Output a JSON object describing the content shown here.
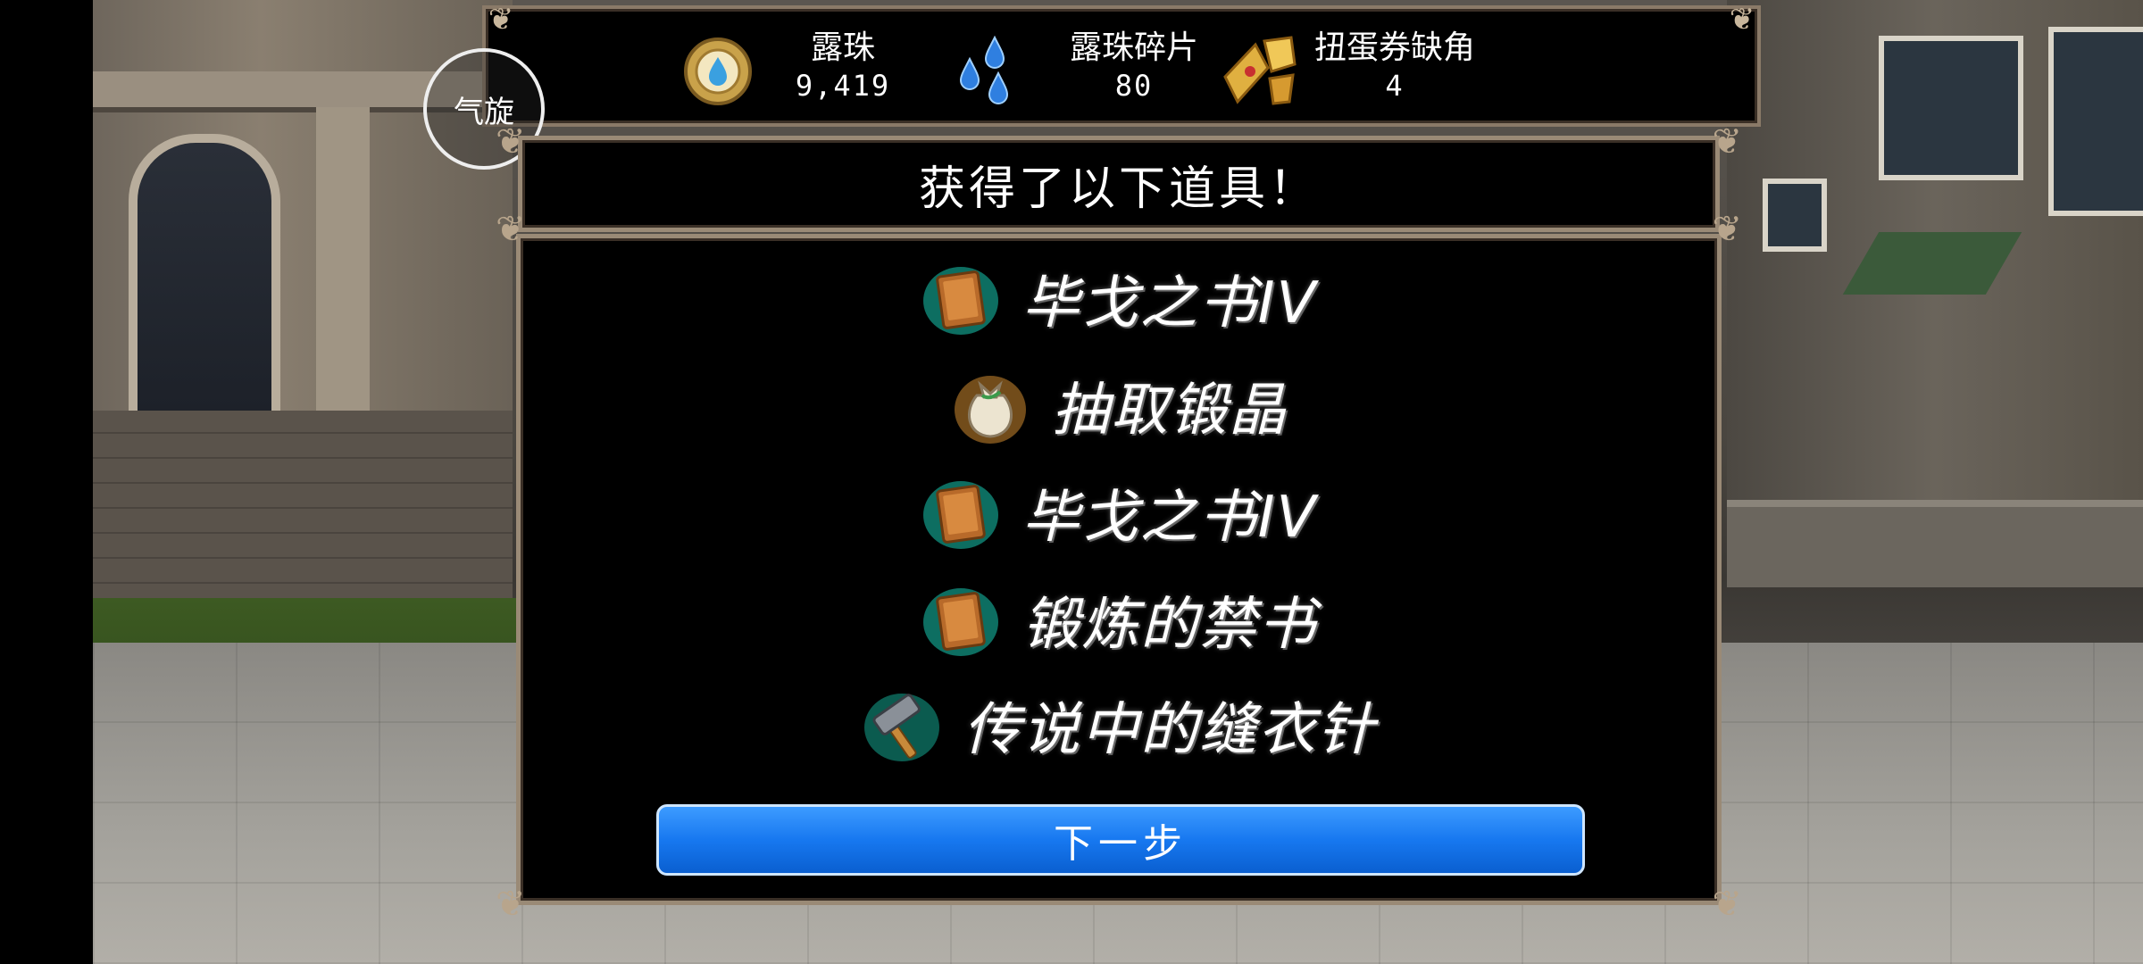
{
  "currencies": [
    {
      "name": "露珠",
      "value": "9,419",
      "icon": "dew-orb-icon"
    },
    {
      "name": "露珠碎片",
      "value": "80",
      "icon": "dew-fragment-icon"
    },
    {
      "name": "扭蛋券缺角",
      "value": "4",
      "icon": "gacha-ticket-fragment-icon"
    }
  ],
  "qixuan_button": {
    "label": "气旋"
  },
  "dialog": {
    "title": "获得了以下道具！",
    "items": [
      {
        "label": "毕戈之书IV",
        "icon": "book-icon"
      },
      {
        "label": "抽取锻晶",
        "icon": "pouch-icon"
      },
      {
        "label": "毕戈之书IV",
        "icon": "book-icon"
      },
      {
        "label": "锻炼的禁书",
        "icon": "book-icon"
      },
      {
        "label": "传说中的缝衣针",
        "icon": "hammer-icon"
      }
    ],
    "next_button": "下一步"
  },
  "colors": {
    "button_blue": "#1778f0",
    "frame": "#9a8a76",
    "item_glow": "#18c9b0"
  }
}
